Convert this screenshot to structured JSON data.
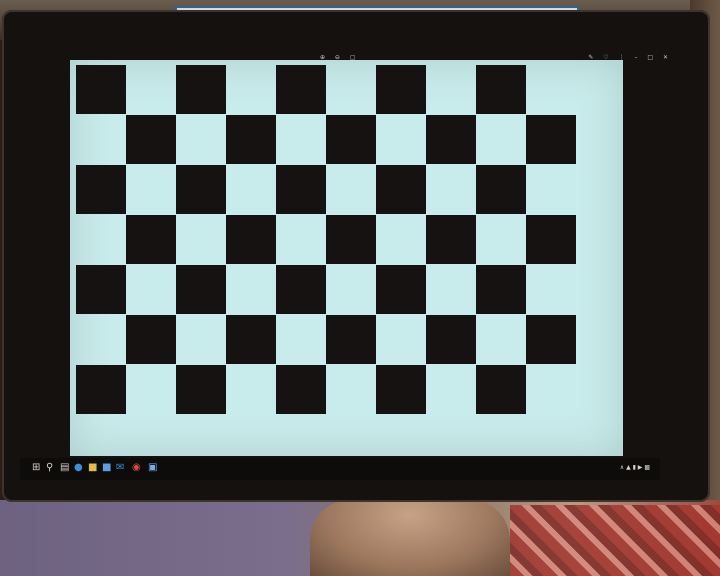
{
  "viewer": {
    "board": {
      "rows": 7,
      "cols": 10,
      "dark_color": "#151211",
      "light_color": "#c8eceb"
    }
  },
  "icons": {
    "taskbar": [
      "windows-start-icon",
      "search-icon",
      "task-view-icon",
      "edge-icon",
      "file-explorer-icon",
      "store-icon",
      "mail-icon",
      "chrome-icon",
      "photos-icon"
    ],
    "titlebar": [
      "zoom-in-icon",
      "zoom-out-icon",
      "crop-icon",
      "draw-icon",
      "share-icon",
      "more-icon"
    ]
  }
}
